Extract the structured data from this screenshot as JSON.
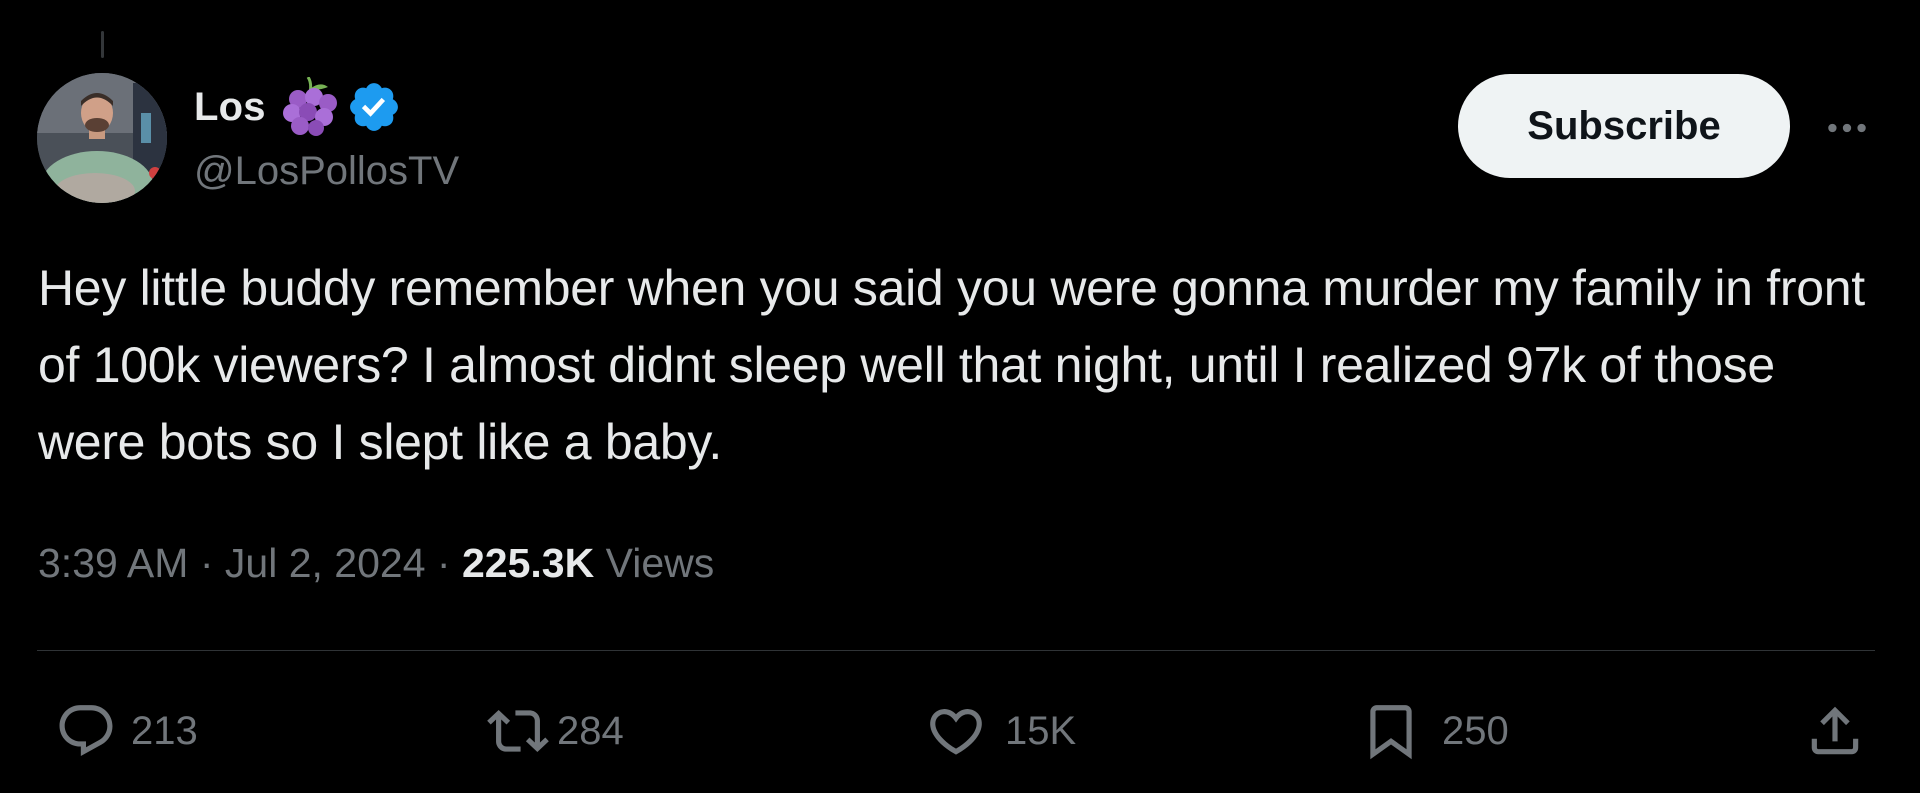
{
  "author": {
    "display_name": "Los",
    "handle": "@LosPollosTV",
    "emoji_icon": "grapes-icon",
    "verified_icon": "verified-badge-icon"
  },
  "header": {
    "subscribe_label": "Subscribe",
    "more_icon": "more-icon"
  },
  "tweet": {
    "text": "Hey little buddy remember when you said you were gonna murder my family in front of 100k viewers? I almost didnt sleep well that night, until I realized 97k of those were bots so I slept like a baby."
  },
  "meta": {
    "time": "3:39 AM",
    "separator": "·",
    "date": "Jul 2, 2024",
    "views_count": "225.3K",
    "views_label": "Views"
  },
  "actions": {
    "replies": "213",
    "reposts": "284",
    "likes": "15K",
    "bookmarks": "250"
  },
  "colors": {
    "background": "#000000",
    "text_primary": "#e7e9ea",
    "text_secondary": "#71767b",
    "verified": "#1d9bf0",
    "subscribe_bg": "#eff3f4",
    "divider": "#2f3336"
  }
}
